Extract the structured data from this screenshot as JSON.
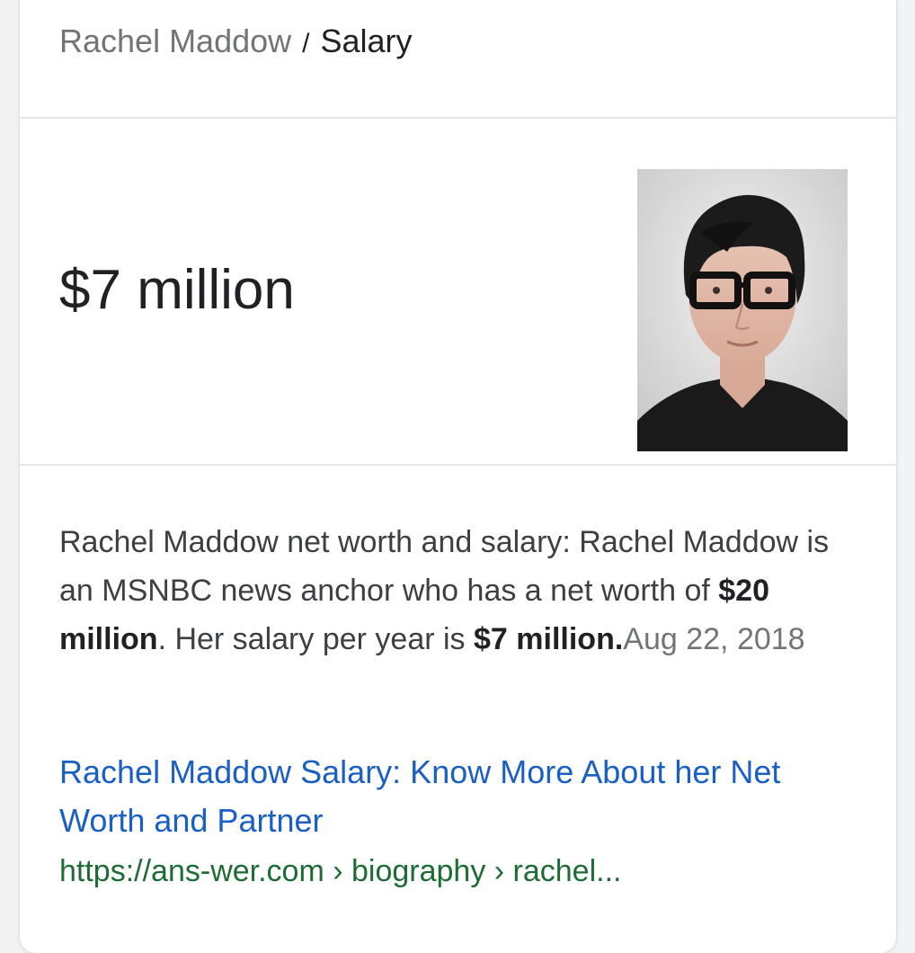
{
  "breadcrumb": {
    "entity": "Rachel Maddow",
    "separator": "/",
    "attribute": "Salary"
  },
  "answer": {
    "value": "$7 million"
  },
  "image": {
    "icon": "portrait-photo",
    "subject": "Rachel Maddow"
  },
  "snippet": {
    "text_1": "Rachel Maddow net worth and salary: Rachel Maddow is an MSNBC news anchor who has a net worth of ",
    "bold_1": "$20 million",
    "text_2": ". Her salary per year is ",
    "bold_2": "$7 million",
    "text_3": ".",
    "date": "Aug 22, 2018"
  },
  "result": {
    "title": "Rachel Maddow Salary: Know More About her Net Worth and Partner",
    "url": "https://ans-wer.com › biography › rachel..."
  },
  "colors": {
    "link": "#1a5fc4",
    "url": "#1e6b35",
    "muted": "#70757a"
  }
}
